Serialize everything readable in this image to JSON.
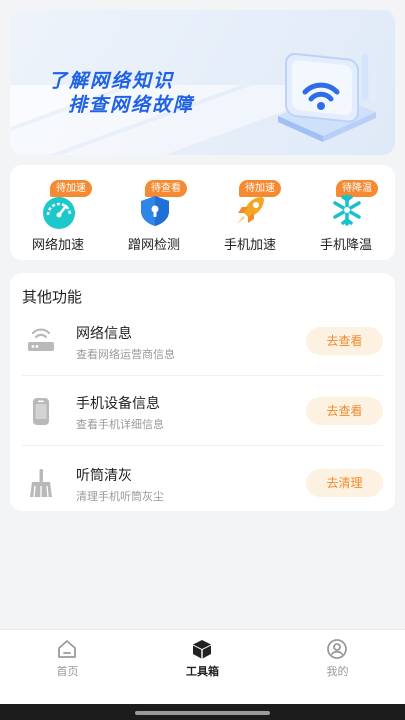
{
  "banner": {
    "line1": "了解网络知识",
    "line2": "排查网络故障"
  },
  "quick_actions": [
    {
      "label": "网络加速",
      "badge": "待加速",
      "icon": "speedometer-icon"
    },
    {
      "label": "蹭网检测",
      "badge": "待查看",
      "icon": "shield-lock-icon"
    },
    {
      "label": "手机加速",
      "badge": "待加速",
      "icon": "rocket-icon"
    },
    {
      "label": "手机降温",
      "badge": "待降温",
      "icon": "snowflake-icon"
    }
  ],
  "other_functions": {
    "title": "其他功能",
    "items": [
      {
        "title": "网络信息",
        "subtitle": "查看网络运营商信息",
        "button": "去查看",
        "icon": "router-icon"
      },
      {
        "title": "手机设备信息",
        "subtitle": "查看手机详细信息",
        "button": "去查看",
        "icon": "phone-device-icon"
      },
      {
        "title": "听筒清灰",
        "subtitle": "清理手机听筒灰尘",
        "button": "去清理",
        "icon": "broom-icon"
      }
    ]
  },
  "tabbar": {
    "tabs": [
      {
        "label": "首页",
        "icon": "home-icon",
        "active": false
      },
      {
        "label": "工具箱",
        "icon": "toolbox-cube-icon",
        "active": true
      },
      {
        "label": "我的",
        "icon": "profile-icon",
        "active": false
      }
    ]
  },
  "colors": {
    "accent_orange": "#f58a33",
    "button_bg": "#fdf1e2",
    "banner_text": "#1f62e6",
    "quick_icon_teal": "#1ec7c9",
    "quick_icon_blue": "#2f86e8",
    "quick_icon_orange": "#f5a623"
  }
}
